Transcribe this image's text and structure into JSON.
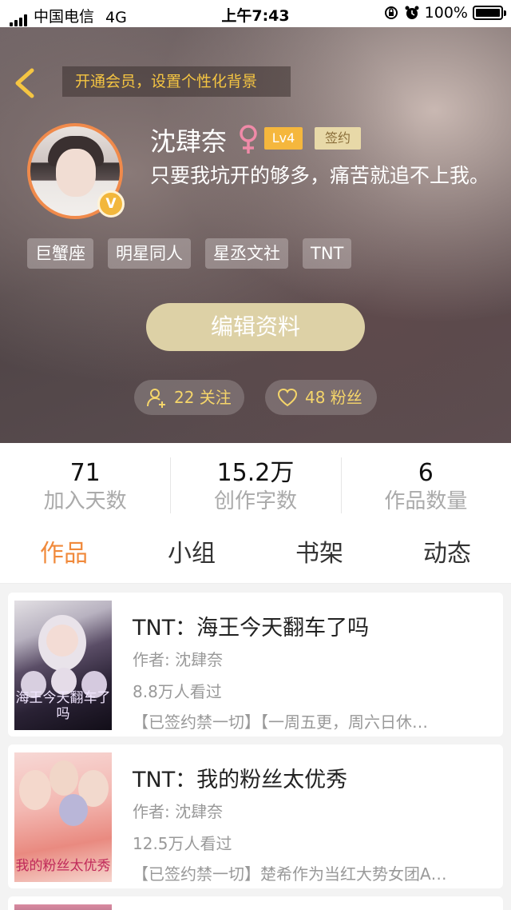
{
  "status_bar": {
    "carrier": "中国电信",
    "network": "4G",
    "time": "上午7:43",
    "battery": "100%"
  },
  "header": {
    "vip_banner": "开通会员，设置个性化背景",
    "username": "沈肆奈",
    "level": "Lv4",
    "signed": "签约",
    "bio": "只要我坑开的够多，痛苦就追不上我。",
    "avatar_badge": "V",
    "tags": [
      "巨蟹座",
      "明星同人",
      "星丞文社",
      "TNT"
    ],
    "edit_label": "编辑资料",
    "follow_label": "22 关注",
    "fans_label": "48 粉丝"
  },
  "stats": [
    {
      "value": "71",
      "label": "加入天数"
    },
    {
      "value": "15.2万",
      "label": "创作字数"
    },
    {
      "value": "6",
      "label": "作品数量"
    }
  ],
  "tabs": [
    {
      "label": "作品",
      "active": true
    },
    {
      "label": "小组",
      "active": false
    },
    {
      "label": "书架",
      "active": false
    },
    {
      "label": "动态",
      "active": false
    }
  ],
  "books": [
    {
      "title": "TNT：海王今天翻车了吗",
      "author": "作者: 沈肆奈",
      "views": "8.8万人看过",
      "desc": "【已签约禁一切】【一周五更，周六日休…",
      "cover_text": "海王今天翻车了吗"
    },
    {
      "title": "TNT：我的粉丝太优秀",
      "author": "作者: 沈肆奈",
      "views": "12.5万人看过",
      "desc": "【已签约禁一切】楚希作为当红大势女团A…",
      "cover_text": "我的粉丝太优秀"
    }
  ],
  "colors": {
    "accent": "#f08a3c",
    "gold": "#f5c542",
    "edit_button": "#ddd1a6"
  },
  "icons": {
    "back": "chevron-left-icon",
    "gender": "female-icon",
    "follow": "add-user-icon",
    "fans": "heart-icon"
  }
}
